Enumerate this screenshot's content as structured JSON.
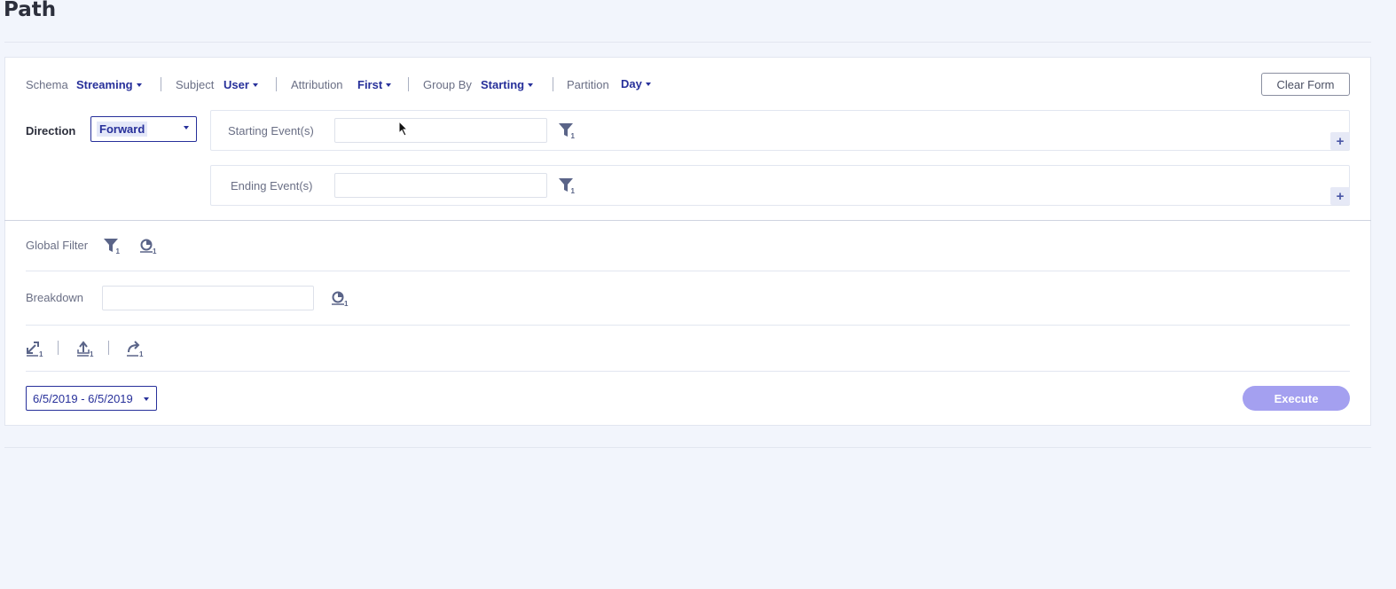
{
  "page": {
    "title": "Path"
  },
  "toolbar": {
    "schema_label": "Schema",
    "schema_value": "Streaming",
    "subject_label": "Subject",
    "subject_value": "User",
    "attribution_label": "Attribution",
    "attribution_value": "First",
    "groupby_label": "Group By",
    "groupby_value": "Starting",
    "partition_label": "Partition",
    "partition_value": "Day",
    "clear_label": "Clear Form"
  },
  "direction": {
    "label": "Direction",
    "value": "Forward"
  },
  "events": {
    "starting_label": "Starting Event(s)",
    "starting_value": "",
    "starting_filter_count": "1",
    "ending_label": "Ending Event(s)",
    "ending_value": "",
    "ending_filter_count": "1",
    "add_label": "+"
  },
  "global_filter": {
    "label": "Global Filter",
    "filter_count": "1",
    "segment_count": "1"
  },
  "breakdown": {
    "label": "Breakdown",
    "value": "",
    "segment_count": "1"
  },
  "options": {
    "icon1_count": "1",
    "icon2_count": "1",
    "icon3_count": "1"
  },
  "footer": {
    "date_range": "6/5/2019 - 6/5/2019",
    "execute_label": "Execute"
  },
  "colors": {
    "accent": "#27309a",
    "execute": "#a4a0f0",
    "icon": "#5a6488",
    "background": "#f2f5fc"
  },
  "icons": [
    "filter-icon",
    "segment-icon",
    "expand-icon",
    "upload-icon",
    "share-icon",
    "plus-icon",
    "caret-down-icon",
    "cursor-icon"
  ]
}
